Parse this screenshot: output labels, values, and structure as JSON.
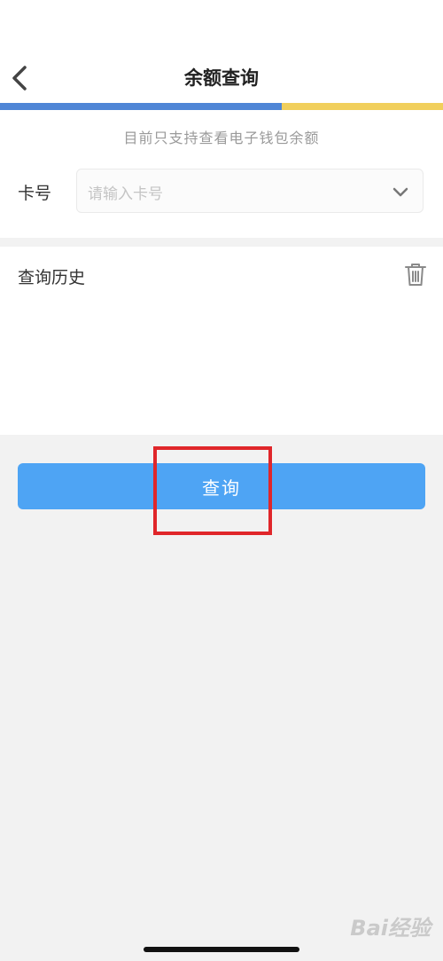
{
  "nav": {
    "title": "余额查询"
  },
  "notice": "目前只支持查看电子钱包余额",
  "card_field": {
    "label": "卡号",
    "placeholder": "请输入卡号"
  },
  "history": {
    "title": "查询历史"
  },
  "query_button": {
    "label": "查询"
  },
  "watermark": "Bai经验",
  "colors": {
    "accent_blue": "#4ea4f4",
    "strip_blue": "#4f86d6",
    "strip_yellow": "#f1cf5c",
    "highlight_red": "#e0262a",
    "background": "#f2f2f2"
  },
  "icons": {
    "back": "chevron-left-icon",
    "dropdown": "chevron-down-icon",
    "delete": "trash-icon"
  }
}
